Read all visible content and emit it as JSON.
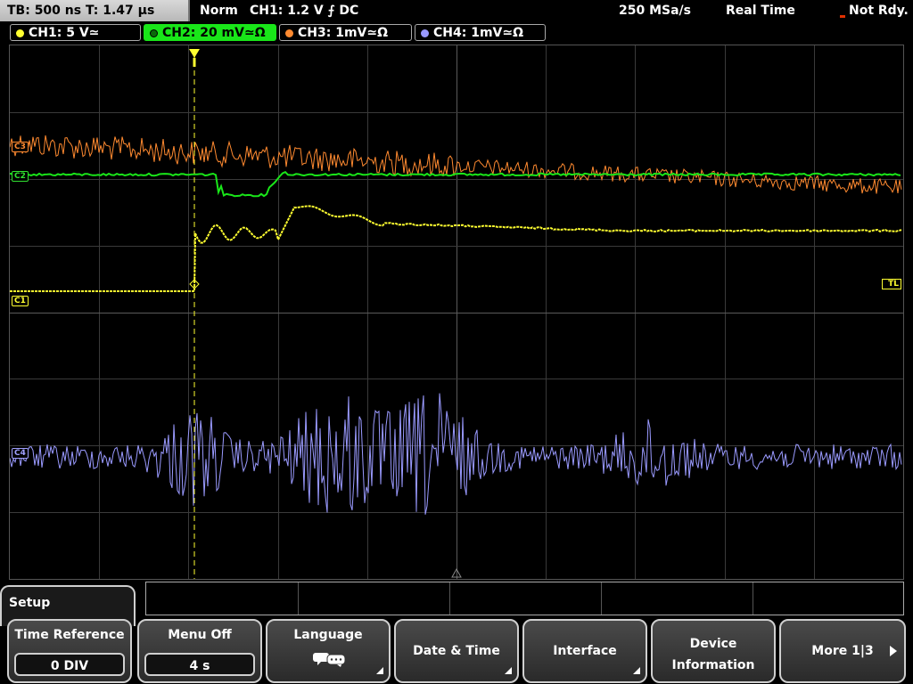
{
  "status": {
    "timebase": "TB: 500 ns   T: 1.47 µs",
    "acq_mode": "Norm",
    "trigger": "CH1: 1.2 V ⨍ DC",
    "sample_rate": "250 MSa/s",
    "run_mode": "Real Time",
    "ready_state": "Not Rdy."
  },
  "channels": [
    {
      "label": "CH1: 5 V≃",
      "color": "#ffff30",
      "marker": "C1"
    },
    {
      "label": "CH2: 20 mV≃Ω",
      "color": "#19e619",
      "marker": "C2"
    },
    {
      "label": "CH3: 1mV≃Ω",
      "color": "#ff8a30",
      "marker": "C3"
    },
    {
      "label": "CH4: 1mV≃Ω",
      "color": "#9a9aff",
      "marker": "C4"
    }
  ],
  "trigger_level_marker": "TL",
  "menu": {
    "title": "Setup",
    "softkeys": [
      {
        "label": "Time Reference",
        "value": "0 DIV"
      },
      {
        "label": "Menu Off",
        "value": "4 s"
      },
      {
        "label": "Language",
        "icon": "speech-bubbles-icon"
      },
      {
        "label": "Date & Time"
      },
      {
        "label": "Interface"
      },
      {
        "label_line1": "Device",
        "label_line2": "Information"
      },
      {
        "label": "More 1|3"
      }
    ]
  }
}
